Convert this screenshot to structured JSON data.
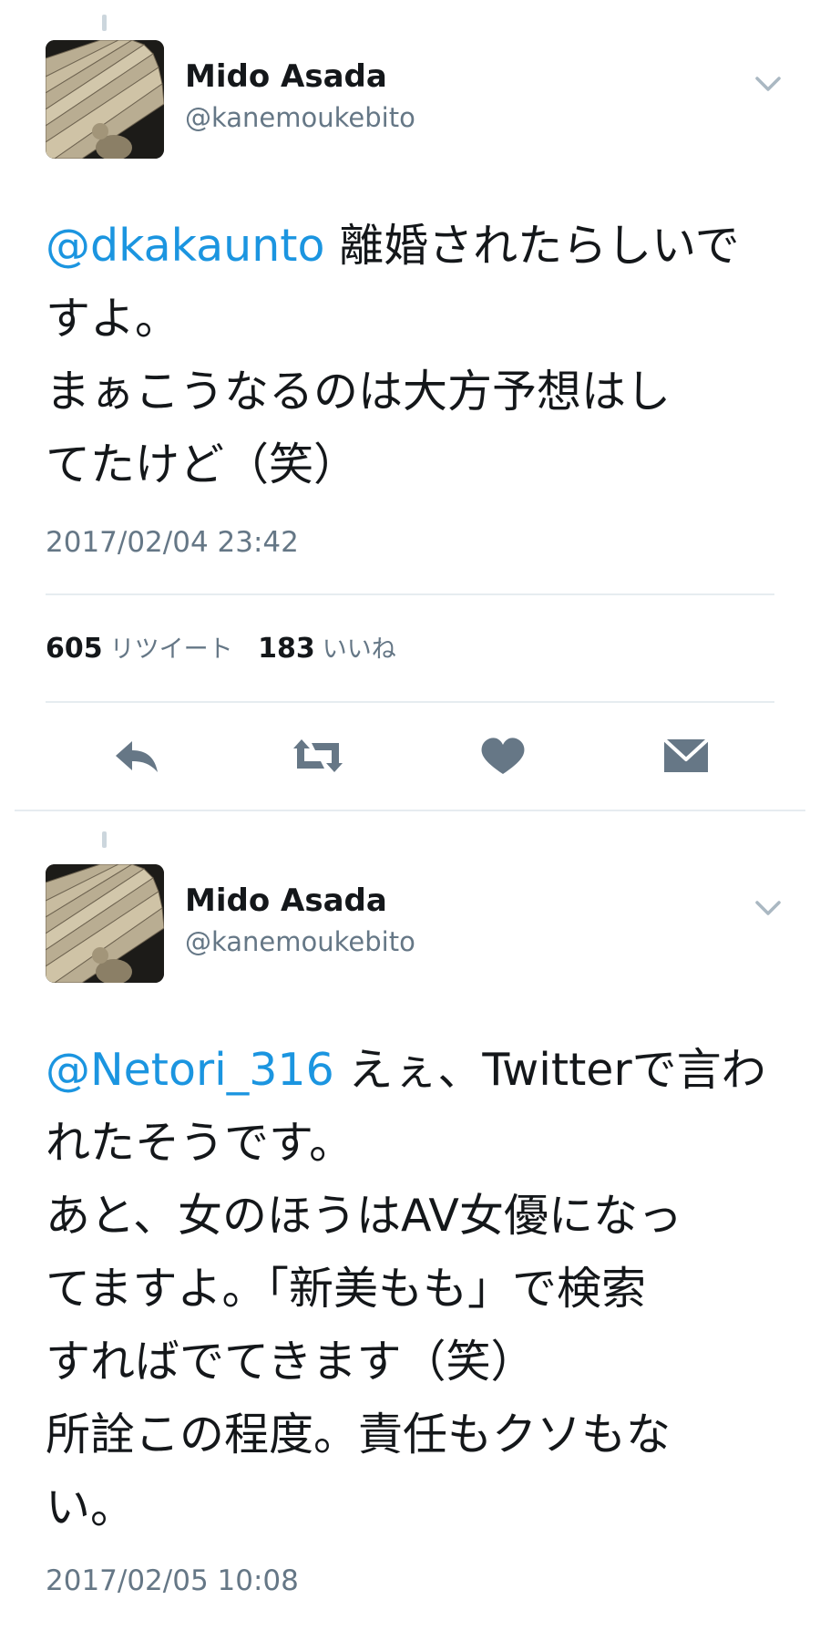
{
  "tweets": [
    {
      "author": {
        "name": "Mido Asada",
        "handle": "@kanemoukebito"
      },
      "mention": "@dkakaunto",
      "lines": [
        "離婚されたらしいで",
        "すよ。",
        "まぁこうなるのは大方予想はし",
        "てたけど（笑）"
      ],
      "timestamp": "2017/02/04 23:42",
      "stats": {
        "retweets": "605",
        "retweets_label": "リツイート",
        "likes": "183",
        "likes_label": "いいね"
      },
      "actions": {
        "reply": "reply-icon",
        "retweet": "retweet-icon",
        "like": "heart-icon",
        "dm": "envelope-icon"
      }
    },
    {
      "author": {
        "name": "Mido Asada",
        "handle": "@kanemoukebito"
      },
      "mention": "@Netori_316",
      "lines": [
        "えぇ、Twitterで言わ",
        "れたそうです。",
        "あと、女のほうはAV女優になっ",
        "てますよ。「新美もも」で検索",
        "すればでてきます（笑）",
        "所詮この程度。責任もクソもな",
        "い。"
      ],
      "timestamp": "2017/02/05 10:08"
    }
  ],
  "colors": {
    "link": "#1b95e0",
    "secondary": "#657786",
    "icon": "#667786",
    "rule": "#e6ecf0"
  }
}
